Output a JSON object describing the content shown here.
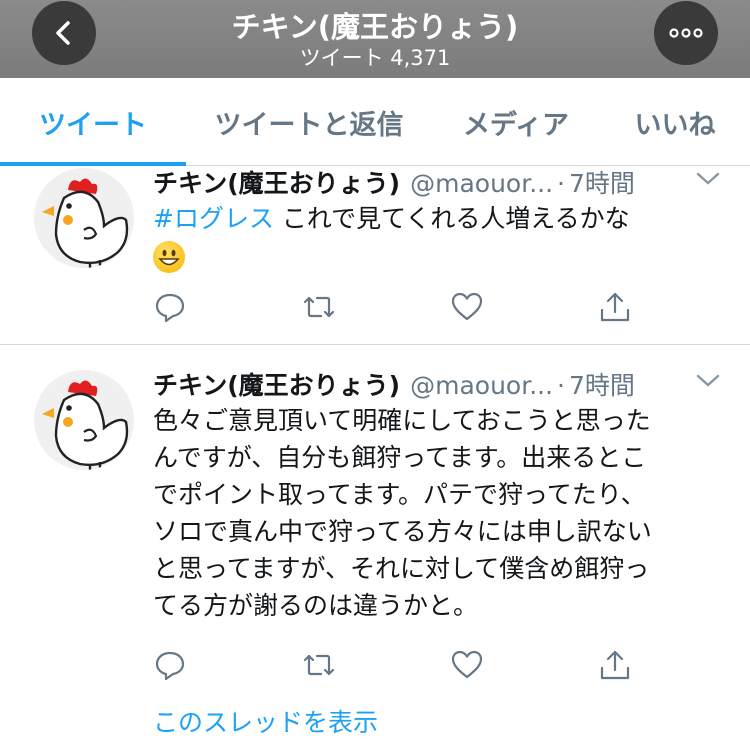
{
  "header": {
    "title": "チキン(魔王おりょう)",
    "subtitle": "ツイート 4,371",
    "back_icon": "chevron-left-icon",
    "more_icon": "more-icon"
  },
  "tabs": [
    {
      "label": "ツイート",
      "active": true
    },
    {
      "label": "ツイートと返信",
      "active": false
    },
    {
      "label": "メディア",
      "active": false
    },
    {
      "label": "いいね",
      "active": false
    }
  ],
  "tweets": [
    {
      "name": "チキン(魔王おりょう)",
      "handle": "@maouor...",
      "dot": "·",
      "time": "7時間",
      "hashtag": "#ログレス",
      "text": " これで見てくれる人増えるかな",
      "emoji": "grinning-face-emoji"
    },
    {
      "name": "チキン(魔王おりょう)",
      "handle": "@maouor...",
      "dot": "·",
      "time": "7時間",
      "lines": [
        "色々ご意見頂いて明確にしておこうと思った",
        "んですが、自分も餌狩ってます。出来るとこ",
        "でポイント取ってます。パテで狩ってたり、",
        "ソロで真ん中で狩ってる方々には申し訳ない",
        "と思ってますが、それに対して僕含め餌狩っ",
        "てる方が謝るのは違うかと。"
      ]
    }
  ],
  "thread_link": "このスレッドを表示",
  "colors": {
    "accent": "#1da1f2",
    "secondary": "#657786",
    "header_bg": "#838383"
  }
}
